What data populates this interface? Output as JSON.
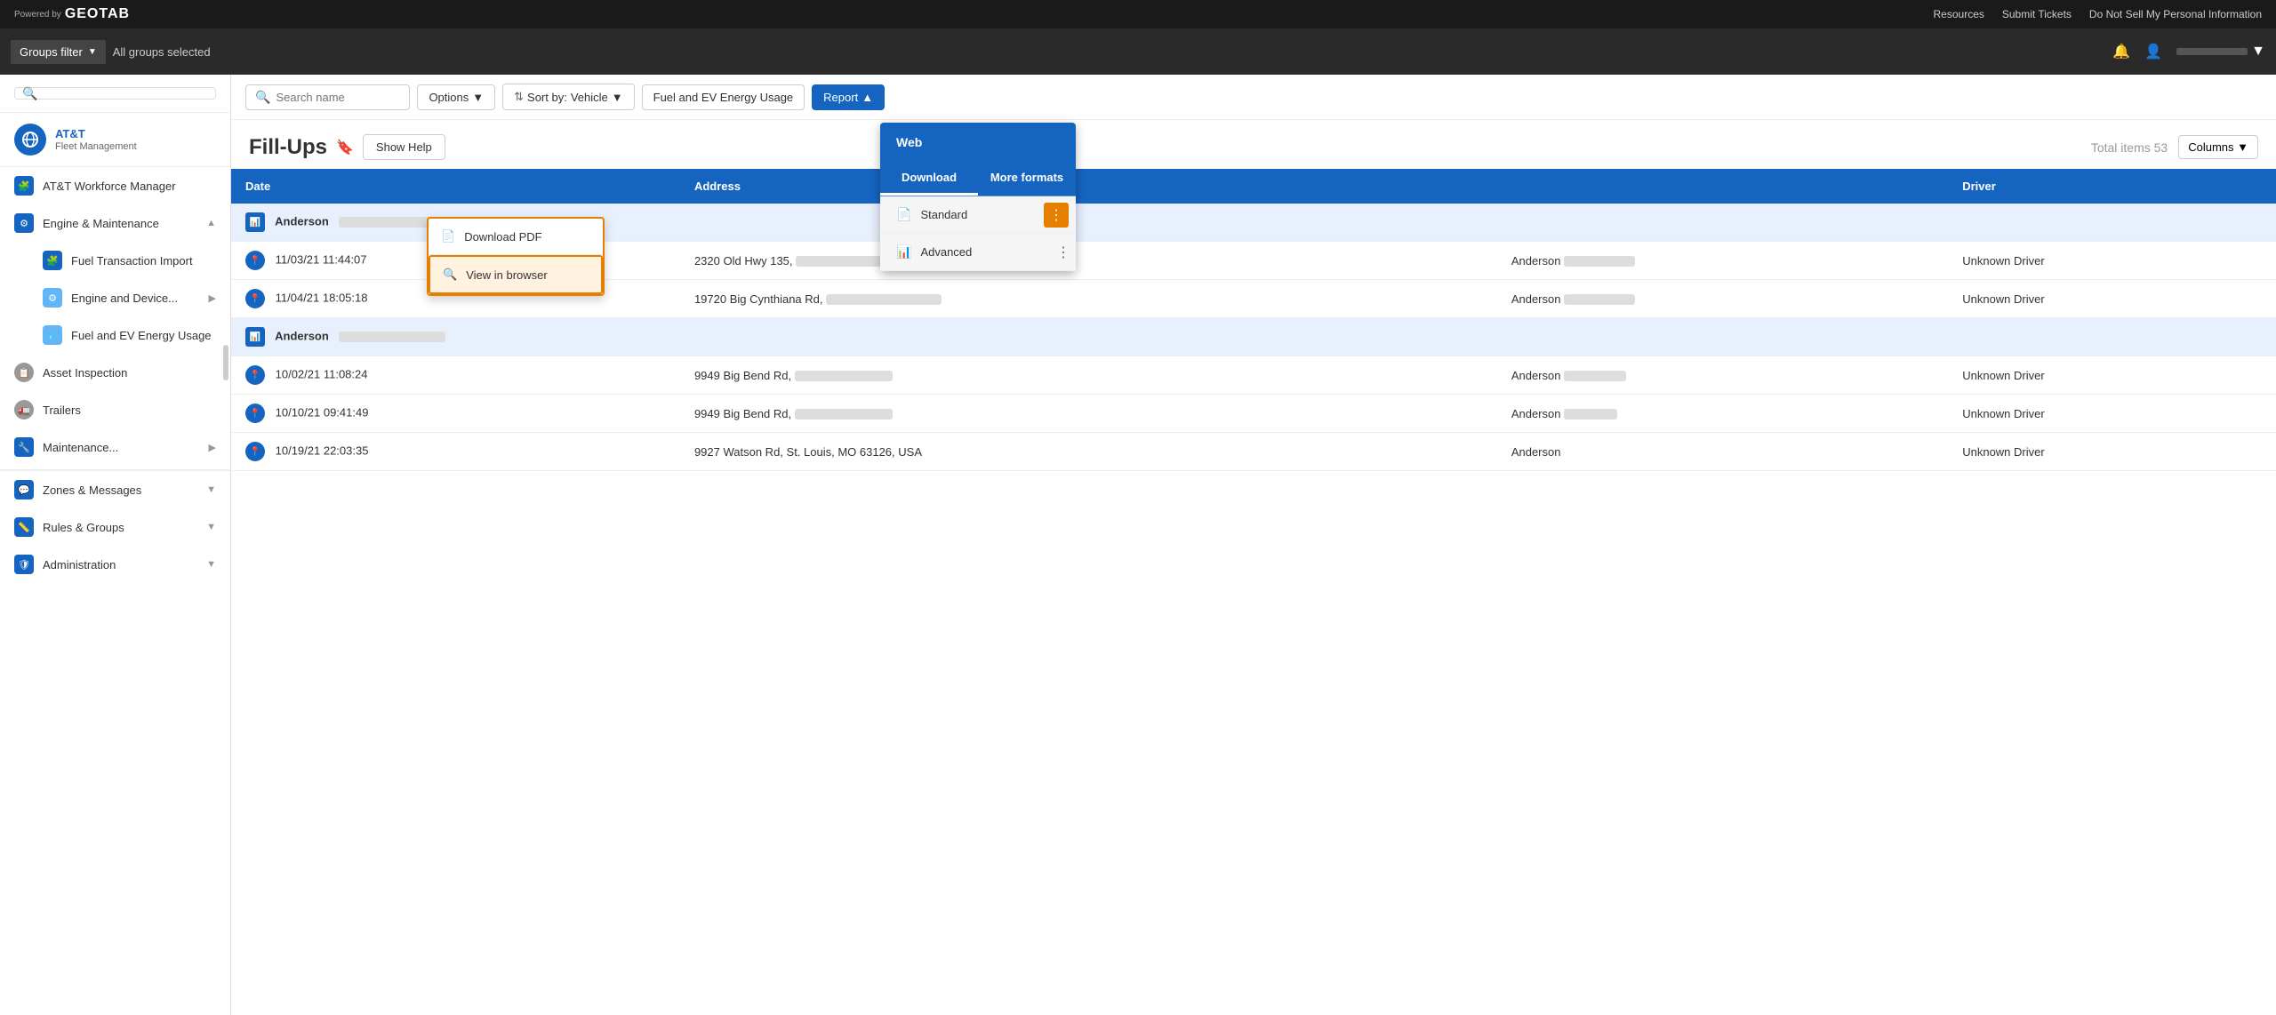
{
  "topbar": {
    "resources": "Resources",
    "submit_tickets": "Submit Tickets",
    "do_not_sell": "Do Not Sell My Personal Information"
  },
  "groups_bar": {
    "filter_label": "Groups filter",
    "all_groups": "All groups selected"
  },
  "logo": {
    "powered_by": "Powered by",
    "brand": "GEOTAB",
    "company": "AT&T",
    "sub": "Fleet Management"
  },
  "toolbar": {
    "search_placeholder": "Search name",
    "options_label": "Options",
    "sort_label": "Sort by:",
    "sort_value": "Vehicle",
    "filter_label": "Fuel and EV Energy Usage",
    "report_label": "Report"
  },
  "page_header": {
    "title": "Fill-Ups",
    "show_help": "Show Help",
    "total_items": "Total items 53",
    "columns_btn": "Columns"
  },
  "table": {
    "headers": [
      "Date",
      "Address",
      "",
      "Driver"
    ],
    "group1": {
      "name": "Anderson",
      "rows": [
        {
          "date": "11/03/21 11:44:07",
          "address": "2320 Old Hwy 135,",
          "location": "Anderson",
          "driver": "Unknown Driver"
        },
        {
          "date": "11/04/21 18:05:18",
          "address": "19720 Big Cynthiana Rd,",
          "location": "Anderson",
          "driver": "Unknown Driver"
        }
      ]
    },
    "group2": {
      "name": "Anderson",
      "rows": [
        {
          "date": "10/02/21 11:08:24",
          "address": "9949 Big Bend Rd,",
          "location": "Anderson",
          "driver": "Unknown Driver"
        },
        {
          "date": "10/10/21 09:41:49",
          "address": "9949 Big Bend Rd,",
          "location": "Anderson",
          "driver": "Unknown Driver"
        },
        {
          "date": "10/19/21 22:03:35",
          "address": "9927 Watson Rd, St. Louis, MO 63126, USA",
          "location": "Anderson",
          "driver": "Unknown Driver"
        }
      ]
    }
  },
  "report_dropdown": {
    "web_item": "Web",
    "tab_download": "Download",
    "tab_more": "More formats",
    "item1": "Standard",
    "item2": "Advanced",
    "sub_pdf": "Download PDF",
    "sub_browser": "View in browser"
  },
  "sidebar": {
    "items": [
      {
        "label": "AT&T Workforce Manager",
        "icon": "puzzle",
        "has_chevron": false
      },
      {
        "label": "Engine & Maintenance",
        "icon": "settings",
        "has_chevron": true,
        "expanded": true
      },
      {
        "label": "Fuel Transaction Import",
        "icon": "puzzle",
        "has_chevron": false,
        "sub": true
      },
      {
        "label": "Engine and Device...",
        "icon": "settings",
        "has_chevron": true,
        "sub": true
      },
      {
        "label": "Fuel and EV Energy Usage",
        "icon": "fuel",
        "has_chevron": false,
        "sub": true
      },
      {
        "label": "Asset Inspection",
        "icon": "circle",
        "has_chevron": false
      },
      {
        "label": "Trailers",
        "icon": "circle",
        "has_chevron": false
      },
      {
        "label": "Maintenance...",
        "icon": "wrench",
        "has_chevron": true
      },
      {
        "label": "Zones & Messages",
        "icon": "message",
        "has_chevron": true,
        "section": true
      },
      {
        "label": "Rules & Groups",
        "icon": "rules",
        "has_chevron": true
      },
      {
        "label": "Administration",
        "icon": "admin",
        "has_chevron": true
      }
    ]
  }
}
